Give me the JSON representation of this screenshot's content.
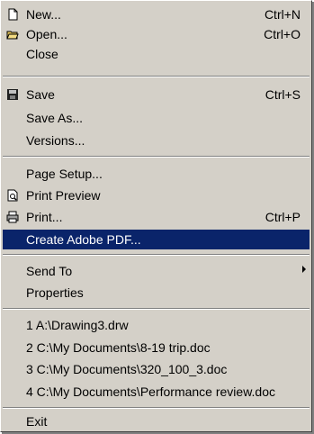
{
  "menu": {
    "items": [
      {
        "label": "New...",
        "shortcut": "Ctrl+N",
        "icon": "new-document-icon"
      },
      {
        "label": "Open...",
        "shortcut": "Ctrl+O",
        "icon": "open-folder-icon"
      },
      {
        "label": "Close",
        "shortcut": ""
      },
      {
        "label": "Save",
        "shortcut": "Ctrl+S",
        "icon": "save-disk-icon"
      },
      {
        "label": "Save As...",
        "shortcut": ""
      },
      {
        "label": "Versions...",
        "shortcut": ""
      },
      {
        "label": "Page Setup...",
        "shortcut": ""
      },
      {
        "label": "Print Preview",
        "shortcut": "",
        "icon": "print-preview-icon"
      },
      {
        "label": "Print...",
        "shortcut": "Ctrl+P",
        "icon": "printer-icon"
      },
      {
        "label": "Create Adobe PDF...",
        "shortcut": "",
        "highlighted": true
      },
      {
        "label": "Send To",
        "shortcut": "",
        "submenu": true
      },
      {
        "label": "Properties",
        "shortcut": ""
      },
      {
        "label": "1 A:\\Drawing3.drw",
        "shortcut": ""
      },
      {
        "label": "2 C:\\My Documents\\8-19 trip.doc",
        "shortcut": ""
      },
      {
        "label": "3 C:\\My Documents\\320_100_3.doc",
        "shortcut": ""
      },
      {
        "label": "4 C:\\My Documents\\Performance review.doc",
        "shortcut": ""
      },
      {
        "label": "Exit",
        "shortcut": ""
      }
    ]
  },
  "colors": {
    "menu_bg": "#d4d0c8",
    "highlight_bg": "#0a246a",
    "highlight_text": "#ffffff"
  }
}
